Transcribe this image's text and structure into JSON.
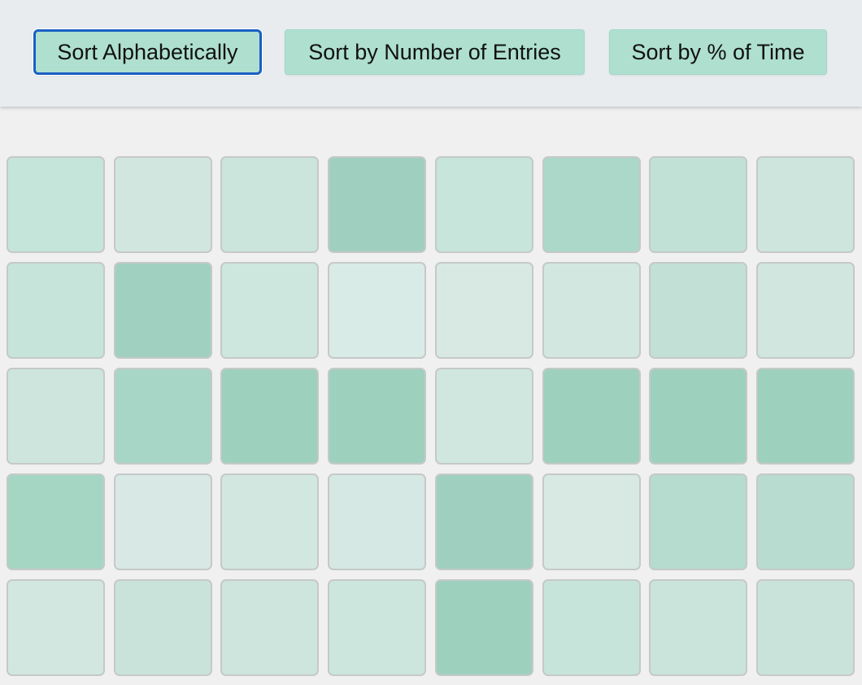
{
  "toolbar": {
    "buttons": [
      {
        "id": "alpha",
        "label": "Sort Alphabetically",
        "active": true
      },
      {
        "id": "entries",
        "label": "Sort by Number of Entries",
        "active": false
      },
      {
        "id": "time",
        "label": "Sort by % of Time",
        "active": false
      }
    ],
    "active_border_color": "#1a5fc4",
    "button_color": "#aedfcf"
  },
  "grid": {
    "columns": 8,
    "tiles": [
      {
        "color": "#c5e4da"
      },
      {
        "color": "#d2e6e0"
      },
      {
        "color": "#cbe4dc"
      },
      {
        "color": "#9fd0bf"
      },
      {
        "color": "#c7e5da"
      },
      {
        "color": "#abd8c8"
      },
      {
        "color": "#c2e1d6"
      },
      {
        "color": "#cde5dd"
      },
      {
        "color": "#c6e4da"
      },
      {
        "color": "#a0d1c0"
      },
      {
        "color": "#cde7de"
      },
      {
        "color": "#d9ebe6"
      },
      {
        "color": "#d8e9e4"
      },
      {
        "color": "#d3e7e1"
      },
      {
        "color": "#c2e0d5"
      },
      {
        "color": "#d0e6df"
      },
      {
        "color": "#cde5dd"
      },
      {
        "color": "#a7d6c6"
      },
      {
        "color": "#9ed0be"
      },
      {
        "color": "#9ed0be"
      },
      {
        "color": "#d0e7df"
      },
      {
        "color": "#9ed0be"
      },
      {
        "color": "#9ed0be"
      },
      {
        "color": "#9ed0be"
      },
      {
        "color": "#a5d6c4"
      },
      {
        "color": "#d8e8e4"
      },
      {
        "color": "#d3e7e1"
      },
      {
        "color": "#d5e8e3"
      },
      {
        "color": "#9fd0bf"
      },
      {
        "color": "#d8e9e4"
      },
      {
        "color": "#b6dccf"
      },
      {
        "color": "#b8ddd0"
      },
      {
        "color": "#d2e7e0"
      },
      {
        "color": "#c9e3da"
      },
      {
        "color": "#cde5dd"
      },
      {
        "color": "#cce6dd"
      },
      {
        "color": "#9ed0be"
      },
      {
        "color": "#c6e4da"
      },
      {
        "color": "#cae4db"
      },
      {
        "color": "#cae3da"
      }
    ]
  }
}
